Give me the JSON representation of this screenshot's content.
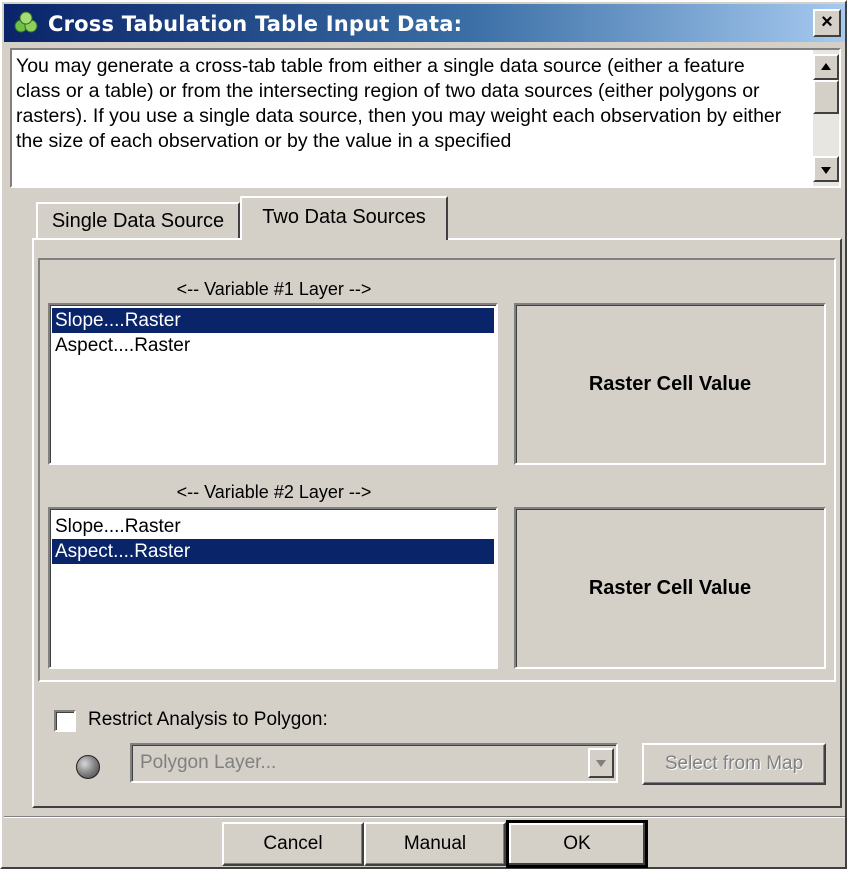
{
  "window": {
    "title": "Cross Tabulation Table Input Data:",
    "close_label": "×"
  },
  "description": {
    "text": "You may generate a cross-tab table from either a single data source (either a feature class or a table) or from the intersecting region of two data sources (either polygons or rasters).  If you use a single data source, then you may weight each observation by either the size of each observation or by the value in a specified"
  },
  "tabs": [
    {
      "label": "Single Data Source",
      "active": false
    },
    {
      "label": "Two Data Sources",
      "active": true
    }
  ],
  "variable1": {
    "label": "<-- Variable #1 Layer -->",
    "items": [
      "Slope....Raster",
      "Aspect....Raster"
    ],
    "selected": "Slope....Raster",
    "value_type": "Raster Cell Value"
  },
  "variable2": {
    "label": "<-- Variable #2 Layer -->",
    "items": [
      "Slope....Raster",
      "Aspect....Raster"
    ],
    "selected": "Aspect....Raster",
    "value_type": "Raster Cell Value"
  },
  "restrict": {
    "label": "Restrict Analysis to Polygon:",
    "checked": false,
    "polygon_placeholder": "Polygon Layer...",
    "select_from_map": "Select from Map"
  },
  "buttons": {
    "cancel": "Cancel",
    "manual": "Manual",
    "ok": "OK"
  },
  "colors": {
    "selection": "#0a246a",
    "face": "#d4d0c8"
  }
}
